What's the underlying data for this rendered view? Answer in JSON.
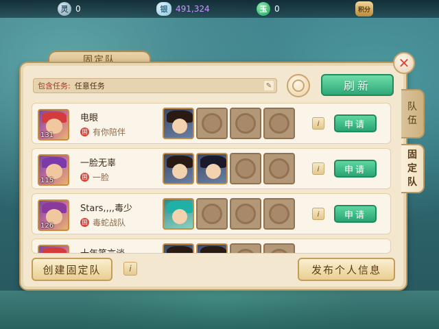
{
  "resources": [
    {
      "icon": "spirit-coin-icon",
      "glyph": "灵",
      "value": "0"
    },
    {
      "icon": "silver-ingot-icon",
      "glyph": "银",
      "value": "491,324"
    },
    {
      "icon": "jade-icon",
      "glyph": "玉",
      "value": "0"
    },
    {
      "icon": "points-badge-icon",
      "glyph": "积分",
      "value": ""
    }
  ],
  "panel": {
    "tab_title": "固定队",
    "close_glyph": "✕",
    "side_tabs": [
      {
        "label": "队伍",
        "chars": [
          "队",
          "伍"
        ]
      },
      {
        "label": "固定队",
        "chars": [
          "固",
          "定",
          "队"
        ]
      }
    ]
  },
  "filter": {
    "label": "包含任务:",
    "value": "任意任务",
    "edit_glyph": "✎"
  },
  "refresh_label": "刷新",
  "teams": [
    {
      "name": "电眼",
      "level": "131",
      "tag": "固",
      "team": "有你陪伴",
      "filled": 1,
      "apply": "申请"
    },
    {
      "name": "一脸无辜",
      "level": "115",
      "tag": "固",
      "team": "一脸",
      "filled": 2,
      "apply": "申请"
    },
    {
      "name": "Stars,,,,毒少",
      "level": "126",
      "tag": "固",
      "team": "毒蛇战队",
      "filled": 1,
      "apply": "申请"
    },
    {
      "name": "十年笑言谈",
      "level": "",
      "tag": "",
      "team": "",
      "filled": 2,
      "apply": "申请"
    }
  ],
  "info_glyph": "i",
  "bottom": {
    "create_label": "创建固定队",
    "publish_label": "发布个人信息"
  }
}
